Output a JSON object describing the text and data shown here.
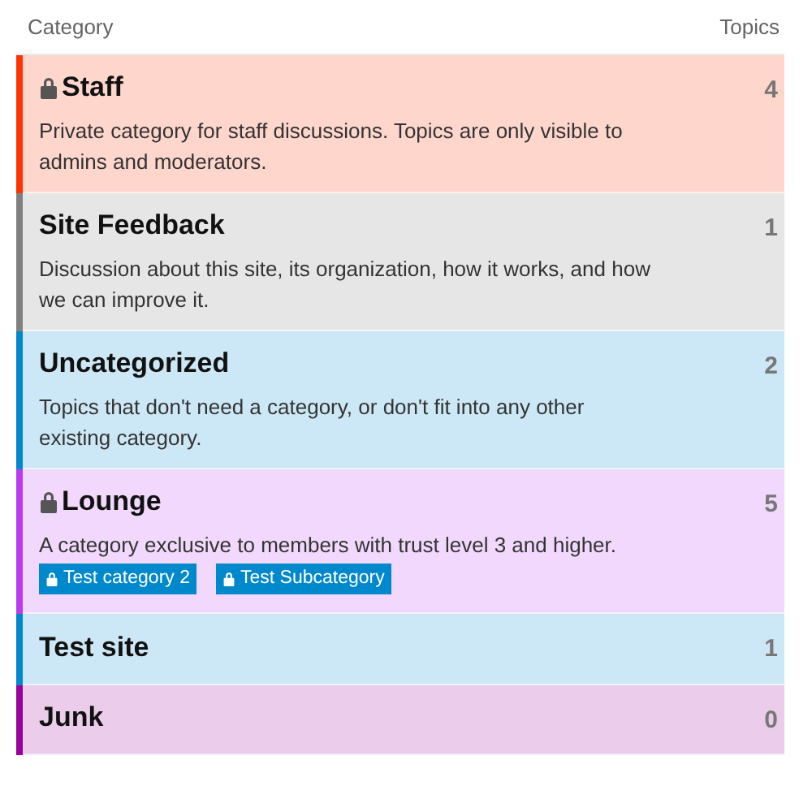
{
  "table": {
    "columns": [
      "Category",
      "Topics"
    ],
    "rows": [
      {
        "name": "Staff",
        "locked": true,
        "color": "#ff3300",
        "description": "Private category for staff discussions. Topics are only visible to admins and moderators.",
        "topics": "4"
      },
      {
        "name": "Site Feedback",
        "locked": false,
        "color": "#808080",
        "description": "Discussion about this site, its organization, how it works, and how we can improve it.",
        "topics": "1"
      },
      {
        "name": "Uncategorized",
        "locked": false,
        "color": "#0088cc",
        "description": "Topics that don't need a category, or don't fit into any other existing category.",
        "topics": "2"
      },
      {
        "name": "Lounge",
        "locked": true,
        "color": "#b93cf0",
        "description": "A category exclusive to members with trust level 3 and higher.",
        "topics": "5",
        "subcategories": [
          {
            "name": "Test category 2",
            "locked": true
          },
          {
            "name": "Test Subcategory",
            "locked": true
          }
        ]
      },
      {
        "name": "Test site",
        "locked": false,
        "color": "#0088cc",
        "topics": "1"
      },
      {
        "name": "Junk",
        "locked": false,
        "color": "#990099",
        "topics": "0"
      }
    ]
  }
}
